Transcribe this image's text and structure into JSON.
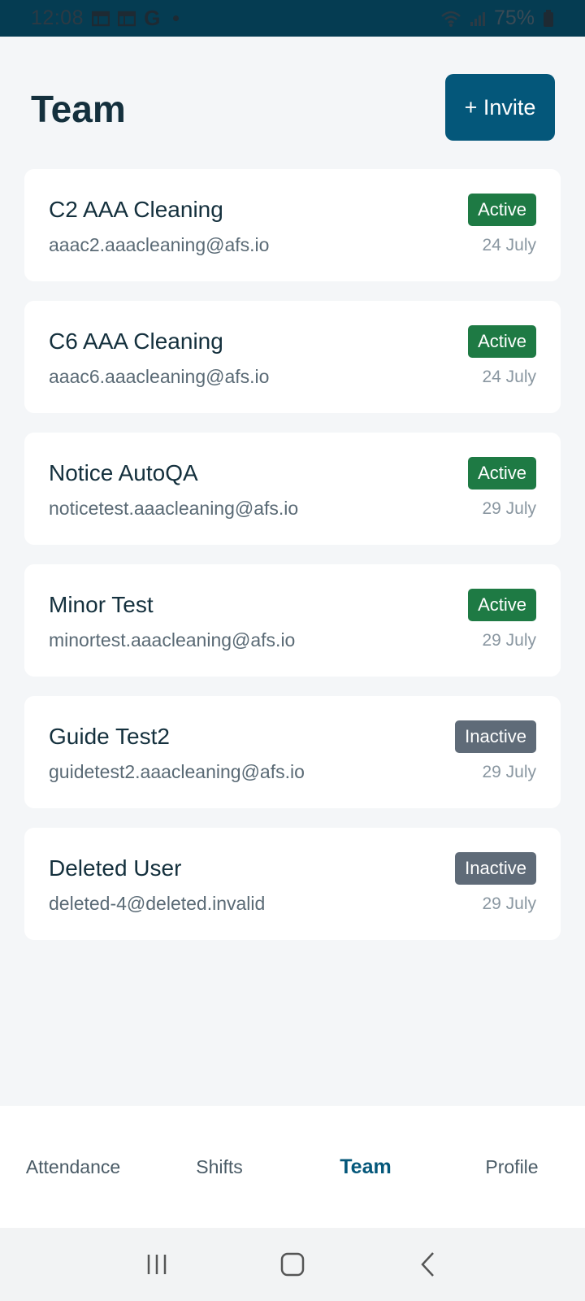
{
  "status_bar": {
    "time": "12:08",
    "left_icons": [
      "calendar-icon",
      "calendar-icon",
      "google-icon",
      "dot-icon"
    ],
    "google_letter": "G",
    "battery": "75%",
    "right_icons": [
      "wifi-icon",
      "signal-icon",
      "battery-icon"
    ]
  },
  "header": {
    "title": "Team",
    "invite_label": "+ Invite"
  },
  "members": [
    {
      "name": "C2 AAA Cleaning",
      "email": "aaac2.aaacleaning@afs.io",
      "status": "Active",
      "date": "24 July"
    },
    {
      "name": "C6 AAA Cleaning",
      "email": "aaac6.aaacleaning@afs.io",
      "status": "Active",
      "date": "24 July"
    },
    {
      "name": "Notice AutoQA",
      "email": "noticetest.aaacleaning@afs.io",
      "status": "Active",
      "date": "29 July"
    },
    {
      "name": "Minor Test",
      "email": "minortest.aaacleaning@afs.io",
      "status": "Active",
      "date": "29 July"
    },
    {
      "name": "Guide Test2",
      "email": "guidetest2.aaacleaning@afs.io",
      "status": "Inactive",
      "date": "29 July"
    },
    {
      "name": "Deleted User",
      "email": "deleted-4@deleted.invalid",
      "status": "Inactive",
      "date": "29 July"
    }
  ],
  "tabs": [
    {
      "label": "Attendance",
      "selected": false
    },
    {
      "label": "Shifts",
      "selected": false
    },
    {
      "label": "Team",
      "selected": true
    },
    {
      "label": "Profile",
      "selected": false
    }
  ],
  "system_nav": [
    "recents-icon",
    "home-icon",
    "back-icon"
  ],
  "colors": {
    "primary": "#04577a",
    "active_badge": "#1e7a44",
    "inactive_badge": "#5f6b78",
    "background": "#f4f6f8"
  }
}
